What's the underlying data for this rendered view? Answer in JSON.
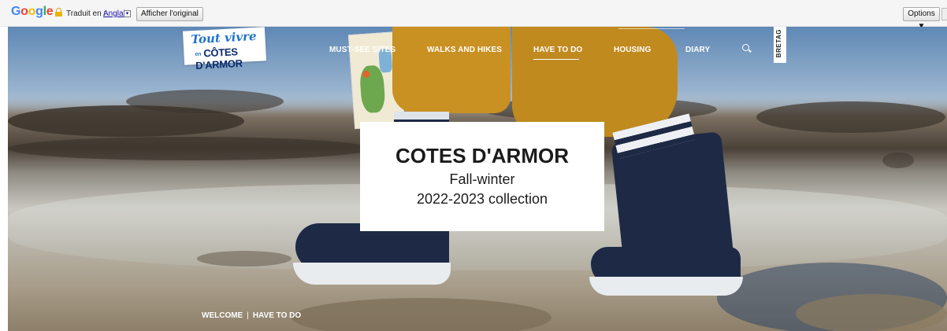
{
  "translate_bar": {
    "logo": "Google",
    "prefix": "Traduit en :",
    "language": "Anglais",
    "dropdown_glyph": "▾",
    "show_original": "Afficher l'original",
    "options": "Options ▼",
    "logo_colors": [
      "#4285f4",
      "#ea4335",
      "#fbbc05",
      "#4285f4",
      "#34a853",
      "#ea4335"
    ]
  },
  "site": {
    "logo_script": "Tout vivre",
    "logo_small": "en",
    "logo_main": "CÔTES D'ARMOR",
    "nav": [
      {
        "label": "MUST-SEE SITES"
      },
      {
        "label": "WALKS AND HIKES"
      },
      {
        "label": "HAVE TO DO",
        "active": true
      },
      {
        "label": "HOUSING"
      },
      {
        "label": "DIARY"
      }
    ],
    "region_tab": "BRETAG"
  },
  "hero": {
    "title": "COTES D'ARMOR",
    "line1": "Fall-winter",
    "line2": "2022-2023 collection"
  },
  "breadcrumb": {
    "home": "WELCOME",
    "separator": "|",
    "current": "HAVE TO DO"
  }
}
